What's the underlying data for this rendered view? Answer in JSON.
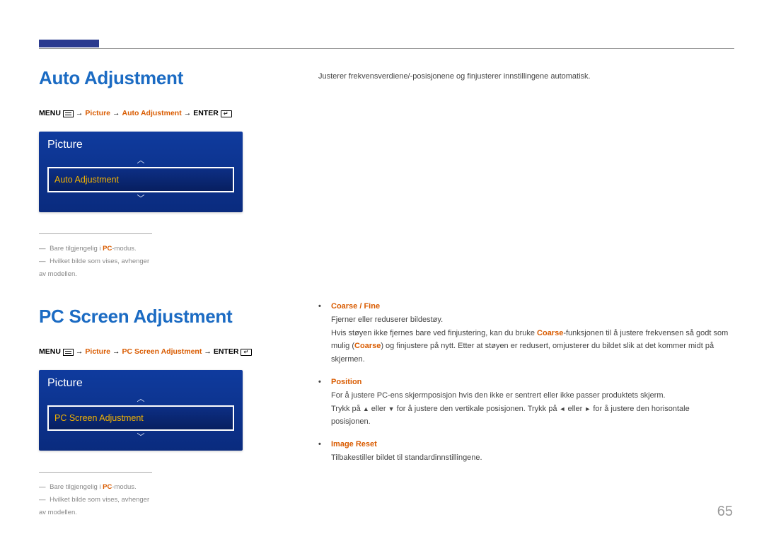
{
  "pageNumber": "65",
  "section1": {
    "heading": "Auto Adjustment",
    "nav": {
      "menu": "MENU",
      "arrow": " → ",
      "p1": "Picture",
      "p2": "Auto Adjustment",
      "enter": "ENTER"
    },
    "osd": {
      "title": "Picture",
      "selected": "Auto Adjustment"
    },
    "footnote1_pre": "Bare tilgjengelig i ",
    "footnote1_pc": "PC",
    "footnote1_post": "-modus.",
    "footnote2": "Hvilket bilde som vises, avhenger av modellen.",
    "intro": "Justerer frekvensverdiene/-posisjonene og finjusterer innstillingene automatisk."
  },
  "section2": {
    "heading": "PC Screen Adjustment",
    "nav": {
      "menu": "MENU",
      "arrow": " → ",
      "p1": "Picture",
      "p2": "PC Screen Adjustment",
      "enter": "ENTER"
    },
    "osd": {
      "title": "Picture",
      "selected": "PC Screen Adjustment"
    },
    "footnote1_pre": "Bare tilgjengelig i ",
    "footnote1_pc": "PC",
    "footnote1_post": "-modus.",
    "footnote2": "Hvilket bilde som vises, avhenger av modellen.",
    "bullets": {
      "b1_label": "Coarse / Fine",
      "b1_line1": "Fjerner eller reduserer bildestøy.",
      "b1_line2_a": "Hvis støyen ikke fjernes bare ved finjustering, kan du bruke ",
      "b1_line2_b": "Coarse",
      "b1_line2_c": "-funksjonen til å justere frekvensen så godt som mulig (",
      "b1_line2_d": "Coarse",
      "b1_line2_e": ") og finjustere på nytt. Etter at støyen er redusert, omjusterer du bildet slik at det kommer midt på skjermen.",
      "b2_label": "Position",
      "b2_line1": "For å justere PC-ens skjermposisjon hvis den ikke er sentrert eller ikke passer produktets skjerm.",
      "b2_line2_a": "Trykk på ",
      "b2_line2_b": " eller ",
      "b2_line2_c": " for å justere den vertikale posisjonen. Trykk på ",
      "b2_line2_d": " eller ",
      "b2_line2_e": " for å justere den horisontale posisjonen.",
      "b3_label": "Image Reset",
      "b3_line1": "Tilbakestiller bildet til standardinnstillingene."
    }
  }
}
